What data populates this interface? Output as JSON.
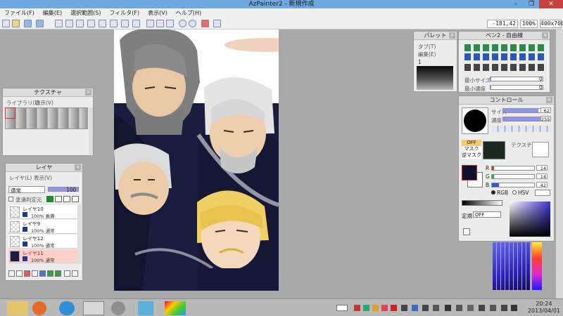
{
  "window": {
    "title": "AzPainter2 - 新規作成"
  },
  "menu": [
    "ファイル(F)",
    "編集(E)",
    "選択範囲(S)",
    "フィルタ(F)",
    "表示(V)",
    "ヘルプ(H)"
  ],
  "readouts": {
    "coords": "-181,42",
    "zoom": "100%",
    "size": "400x700"
  },
  "texture": {
    "title": "テクスチャ",
    "menu_library": "ライブラリ(L)",
    "menu_view": "表示(V)"
  },
  "layer": {
    "title": "レイヤ",
    "menu_layer": "レイヤ(L)",
    "menu_view": "表示(V)",
    "blend_mode": "通常",
    "opacity": "100",
    "checkbox_label": "塗潰判定元",
    "items": [
      {
        "name": "レイヤ10",
        "info": "100% 乗算"
      },
      {
        "name": "レイヤ9",
        "info": "100% 通常"
      },
      {
        "name": "レイヤ12",
        "info": "100% 通常"
      },
      {
        "name": "レイヤ11",
        "info": "100% 通常"
      }
    ]
  },
  "palette": {
    "title": "パレット",
    "menu_tab": "タブ(T)",
    "menu_edit": "編集(E)",
    "index": "1"
  },
  "brush": {
    "title": "ペン2 - 自由線",
    "min_size_label": "最小サイズ",
    "min_size_value": "0",
    "min_density_label": "最小濃度",
    "min_density_value": "0"
  },
  "control": {
    "title": "コントロール",
    "size_label": "サイズ",
    "size_value": "62",
    "density_label": "濃度",
    "density_value": "255",
    "off_label": "OFF",
    "mask_label": "マスク",
    "reverse_mask_label": "逆マスク",
    "texture_label": "テクスチャ",
    "r_label": "R",
    "r_value": "14",
    "g_label": "G",
    "g_value": "14",
    "b_label": "B",
    "b_value": "42",
    "rgb_label": "RGB",
    "hsv_label": "HSV",
    "ruler_label": "定規",
    "ruler_value": "OFF"
  },
  "tray": {
    "time": "20:24",
    "date": "2013/04/01"
  },
  "colors": {
    "draw_color": "#0e0e2a",
    "titlebar": "#6fa9e0",
    "close": "#c74141"
  }
}
